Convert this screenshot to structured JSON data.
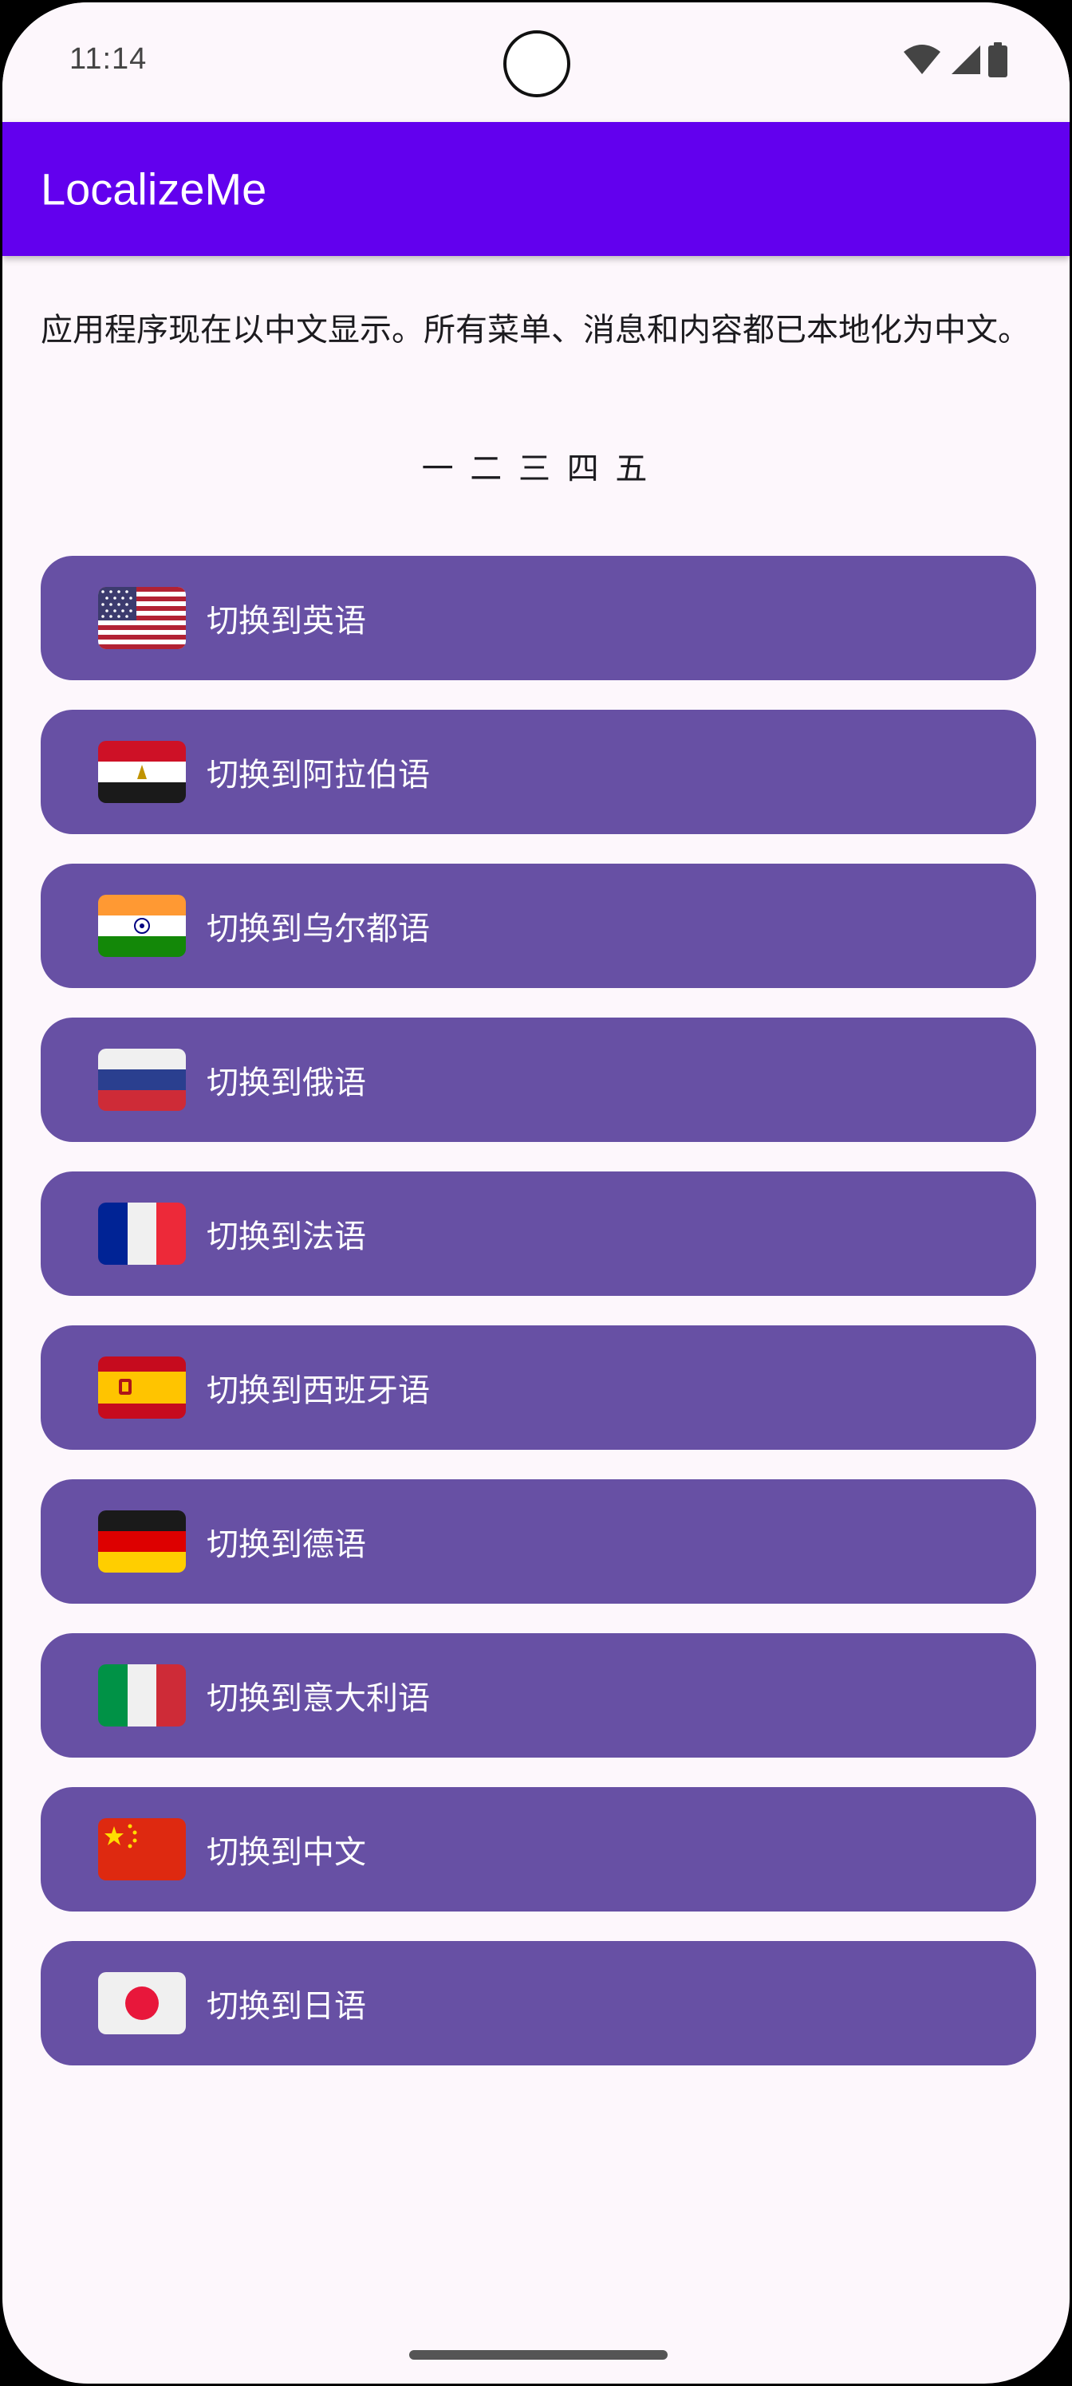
{
  "status_bar": {
    "time": "11:14"
  },
  "app_bar": {
    "title": "LocalizeMe",
    "color": "#6200EE"
  },
  "content": {
    "message": "应用程序现在以中文显示。所有菜单、消息和内容都已本地化为中文。",
    "numbers": "一 二 三 四 五"
  },
  "buttons": [
    {
      "label": "切换到英语",
      "flag": "us-flag-icon"
    },
    {
      "label": "切换到阿拉伯语",
      "flag": "egypt-flag-icon"
    },
    {
      "label": "切换到乌尔都语",
      "flag": "india-flag-icon"
    },
    {
      "label": "切换到俄语",
      "flag": "russia-flag-icon"
    },
    {
      "label": "切换到法语",
      "flag": "france-flag-icon"
    },
    {
      "label": "切换到西班牙语",
      "flag": "spain-flag-icon"
    },
    {
      "label": "切换到德语",
      "flag": "germany-flag-icon"
    },
    {
      "label": "切换到意大利语",
      "flag": "italy-flag-icon"
    },
    {
      "label": "切换到中文",
      "flag": "china-flag-icon"
    },
    {
      "label": "切换到日语",
      "flag": "japan-flag-icon"
    }
  ],
  "colors": {
    "button": "#6750A4",
    "background": "#FDF7FC"
  }
}
